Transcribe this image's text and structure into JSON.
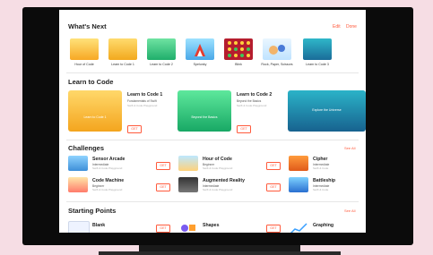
{
  "whats_next": {
    "heading": "What's Next",
    "edit": "Edit",
    "done": "Done",
    "items": [
      {
        "label": "Hour of Code"
      },
      {
        "label": "Learn to Code 1"
      },
      {
        "label": "Learn to Code 2"
      },
      {
        "label": "Spelunky"
      },
      {
        "label": "Blink"
      },
      {
        "label": "Rock, Paper, Scissors"
      },
      {
        "label": "Learn to Code 3"
      }
    ]
  },
  "learn_to_code": {
    "heading": "Learn to Code",
    "cards": [
      {
        "art_text": "Learn to Code 1",
        "title": "Learn to Code 1",
        "subtitle": "Fundamentals of Swift",
        "meta": "Swift & Code Playground",
        "button": "GET"
      },
      {
        "art_text": "Beyond the Basics",
        "title": "Learn to Code 2",
        "subtitle": "Beyond the Basics",
        "meta": "Swift & Code Playground",
        "button": "GET"
      },
      {
        "art_text": "Explore the Universe"
      }
    ]
  },
  "challenges": {
    "heading": "Challenges",
    "see_all": "See All",
    "items": [
      {
        "title": "Sensor Arcade",
        "level": "Intermediate",
        "meta": "Swift & Code Playground",
        "button": "GET"
      },
      {
        "title": "Hour of Code",
        "level": "Beginner",
        "meta": "Swift & Code Playground",
        "button": "GET"
      },
      {
        "title": "Cipher",
        "level": "Intermediate",
        "meta": "Swift & Code"
      },
      {
        "title": "Code Machine",
        "level": "Beginner",
        "meta": "Swift & Code Playground",
        "button": "GET"
      },
      {
        "title": "Augmented Reality",
        "level": "Intermediate",
        "meta": "Swift & Code Playground",
        "button": "GET"
      },
      {
        "title": "Battleship",
        "level": "Intermediate",
        "meta": "Swift & Code"
      }
    ]
  },
  "starting_points": {
    "heading": "Starting Points",
    "see_all": "See All",
    "items": [
      {
        "title": "Blank",
        "button": "GET"
      },
      {
        "title": "Shapes",
        "button": "GET"
      },
      {
        "title": "Graphing"
      }
    ]
  }
}
